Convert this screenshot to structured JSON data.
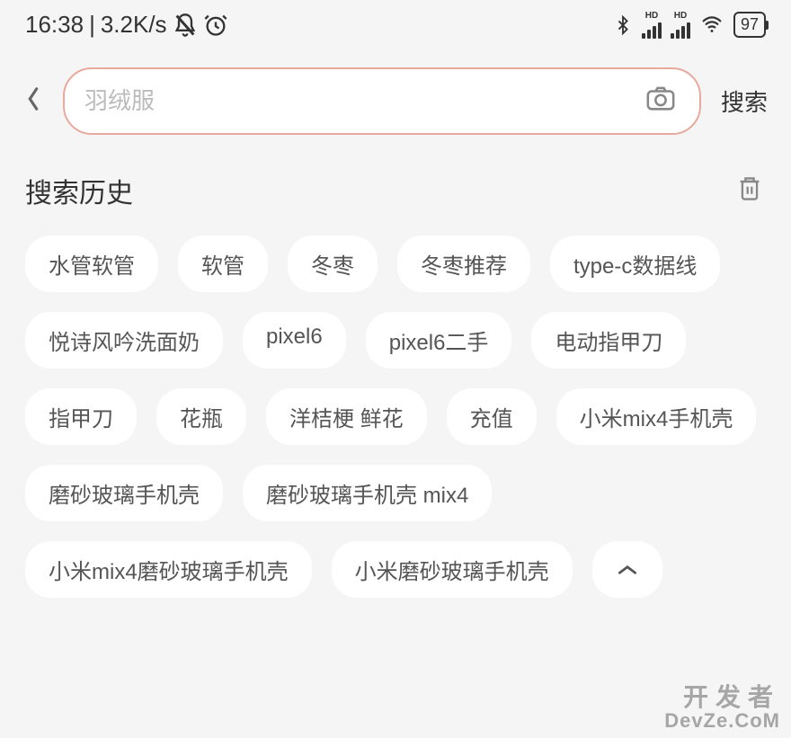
{
  "status": {
    "time": "16:38",
    "speed": "3.2K/s",
    "battery": "97"
  },
  "search": {
    "placeholder": "羽绒服",
    "button_label": "搜索"
  },
  "history": {
    "title": "搜索历史",
    "items": [
      "水管软管",
      "软管",
      "冬枣",
      "冬枣推荐",
      "type-c数据线",
      "悦诗风吟洗面奶",
      "pixel6",
      "pixel6二手",
      "电动指甲刀",
      "指甲刀",
      "花瓶",
      "洋桔梗 鲜花",
      "充值",
      "小米mix4手机壳",
      "磨砂玻璃手机壳",
      "磨砂玻璃手机壳 mix4",
      "小米mix4磨砂玻璃手机壳",
      "小米磨砂玻璃手机壳"
    ]
  },
  "watermark": {
    "line1": "开发者",
    "line2": "DevZe.CoM"
  }
}
